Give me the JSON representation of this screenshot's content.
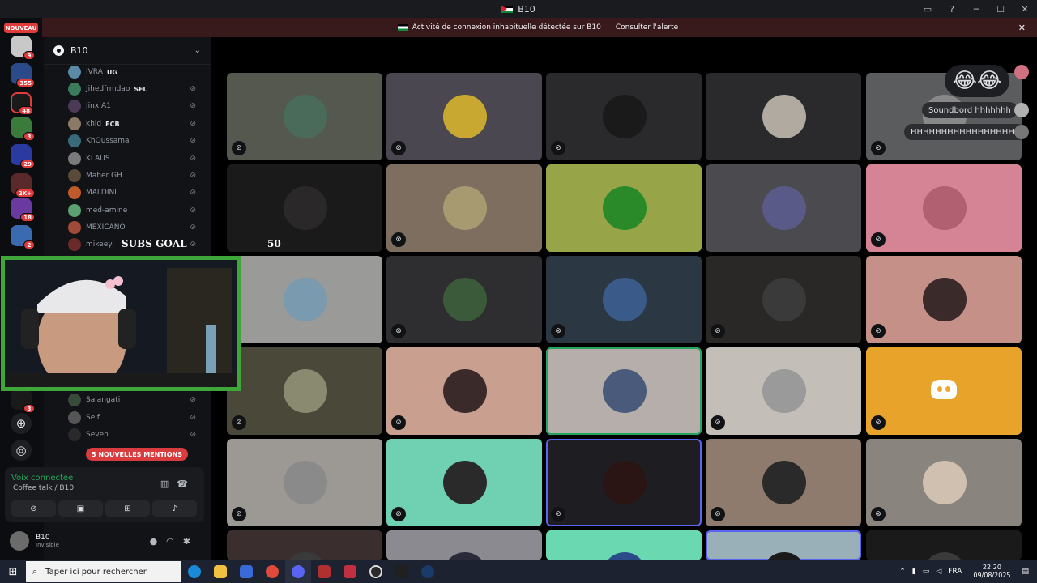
{
  "window": {
    "title": "B10"
  },
  "alert": {
    "text": "Activité de connexion inhabituelle détectée sur B10",
    "button": "Consulter l'alerte",
    "close_icon": "close-icon"
  },
  "servers": {
    "nouveau_label": "NOUVEAU",
    "badges": [
      "9",
      "355",
      "48",
      "3",
      "29",
      "2K+",
      "18",
      "2",
      "3"
    ]
  },
  "server_header": {
    "name": "B10"
  },
  "members": [
    {
      "name": "IVRA",
      "tag": "UG",
      "color": "#5a8aa8"
    },
    {
      "name": "Jihedfrmdao",
      "tag": "SFL",
      "color": "#3b7a5a"
    },
    {
      "name": "Jinx A1",
      "tag": "",
      "color": "#4a3a55"
    },
    {
      "name": "khld",
      "tag": "FCB",
      "color": "#8a7a66"
    },
    {
      "name": "KhOussama",
      "tag": "",
      "color": "#3a6a7a"
    },
    {
      "name": "KLAUS",
      "tag": "",
      "color": "#7a7a7a"
    },
    {
      "name": "Maher GH",
      "tag": "",
      "color": "#5a4a3a"
    },
    {
      "name": "MALDINI",
      "tag": "",
      "color": "#c05a2a"
    },
    {
      "name": "med-amine",
      "tag": "",
      "color": "#5aa070"
    },
    {
      "name": "MEXICANO",
      "tag": "",
      "color": "#a04a3a"
    },
    {
      "name": "mikeey",
      "tag": "",
      "color": "#6a2a2a"
    },
    {
      "name": "Salangati",
      "tag": "",
      "color": "#3a4a3a"
    },
    {
      "name": "Seif",
      "tag": "",
      "color": "#555555"
    },
    {
      "name": "Seven",
      "tag": "",
      "color": "#2a2a2a"
    }
  ],
  "mentions_label": "5 NOUVELLES MENTIONS",
  "voice": {
    "status": "Voix connectée",
    "channel": "Coffee talk / B10"
  },
  "user": {
    "name": "B10",
    "status": "Invisible"
  },
  "overlay": {
    "subs_goal": "SUBS GOAL",
    "subs_count": "50"
  },
  "reactions": {
    "emoji": "😂😂",
    "messages": [
      "Soundbord hhhhhhh",
      "HHHHHHHHHHHHHHHHHH"
    ]
  },
  "tiles": [
    {
      "bg": "#55584f",
      "av": "#4a6a5a",
      "mute": "mic-off"
    },
    {
      "bg": "#4a4750",
      "av": "#c8a830",
      "mute": "mic-off"
    },
    {
      "bg": "#2a2a2c",
      "av": "#1a1a1a",
      "mute": "mic-off"
    },
    {
      "bg": "#2a2a2c",
      "av": "#b0aaa0",
      "mute": ""
    },
    {
      "bg": "#5a5c5e",
      "av": "#888888",
      "mute": "mic-off"
    },
    {
      "bg": "#1a1a1b",
      "av": "#2a2828",
      "mute": ""
    },
    {
      "bg": "#7d6e5f",
      "av": "#a89a70",
      "mute": "deafened"
    },
    {
      "bg": "#98a448",
      "av": "#2a8a2a",
      "mute": ""
    },
    {
      "bg": "#4b4a4e",
      "av": "#5a5a88",
      "mute": ""
    },
    {
      "bg": "#d48494",
      "av": "#b06070",
      "mute": "mic-off"
    },
    {
      "bg": "#9a9a98",
      "av": "#7a9ab0",
      "mute": ""
    },
    {
      "bg": "#2e2e30",
      "av": "#3a5a3a",
      "mute": "deafened"
    },
    {
      "bg": "#2b3743",
      "av": "#3a5a8a",
      "mute": "deafened"
    },
    {
      "bg": "#2a2827",
      "av": "#3a3a3a",
      "mute": "mic-off"
    },
    {
      "bg": "#c49088",
      "av": "#3a2a2a",
      "mute": "mic-off"
    },
    {
      "bg": "#4a4838",
      "av": "#8a8a70",
      "mute": "mic-off"
    },
    {
      "bg": "#c9a090",
      "av": "#3a2a2a",
      "mute": "mic-off"
    },
    {
      "bg": "#b6aeaa",
      "av": "#4a5a7a",
      "mute": "",
      "state": "speak"
    },
    {
      "bg": "#c4beb8",
      "av": "#9a9a9a",
      "mute": "mic-off"
    },
    {
      "bg": "#e8a42a",
      "av": "",
      "mute": "mic-off",
      "logo": "discord-icon"
    },
    {
      "bg": "#9c9894",
      "av": "#8a8a8a",
      "mute": "mic-off"
    },
    {
      "bg": "#6fd1b2",
      "av": "#2a2a2a",
      "mute": "mic-off"
    },
    {
      "bg": "#1e1e22",
      "av": "#2a1414",
      "mute": "mic-off",
      "state": "sel"
    },
    {
      "bg": "#8f7a6e",
      "av": "#2a2a2a",
      "mute": "mic-off"
    },
    {
      "bg": "#8a847e",
      "av": "#d0c0b0",
      "mute": "deafened"
    },
    {
      "bg": "#3a2e2e",
      "av": "#3a3a3a",
      "mute": ""
    },
    {
      "bg": "#8a8a90",
      "av": "#2a2a3a",
      "mute": ""
    },
    {
      "bg": "#6ad8b0",
      "av": "#2a4a8a",
      "mute": ""
    },
    {
      "bg": "#9ab0b8",
      "av": "#1a1a1a",
      "mute": "",
      "state": "sel"
    },
    {
      "bg": "#1a1a1a",
      "av": "#3a3a3a",
      "mute": ""
    }
  ],
  "taskbar": {
    "search_placeholder": "Taper ici pour rechercher",
    "lang": "FRA",
    "time": "22:20",
    "date": "09/08/2025"
  },
  "colors": {
    "accent_green": "#23a55a",
    "alert_bg": "#391a1c",
    "mention_red": "#d83c3e",
    "blurple": "#5865f2"
  }
}
